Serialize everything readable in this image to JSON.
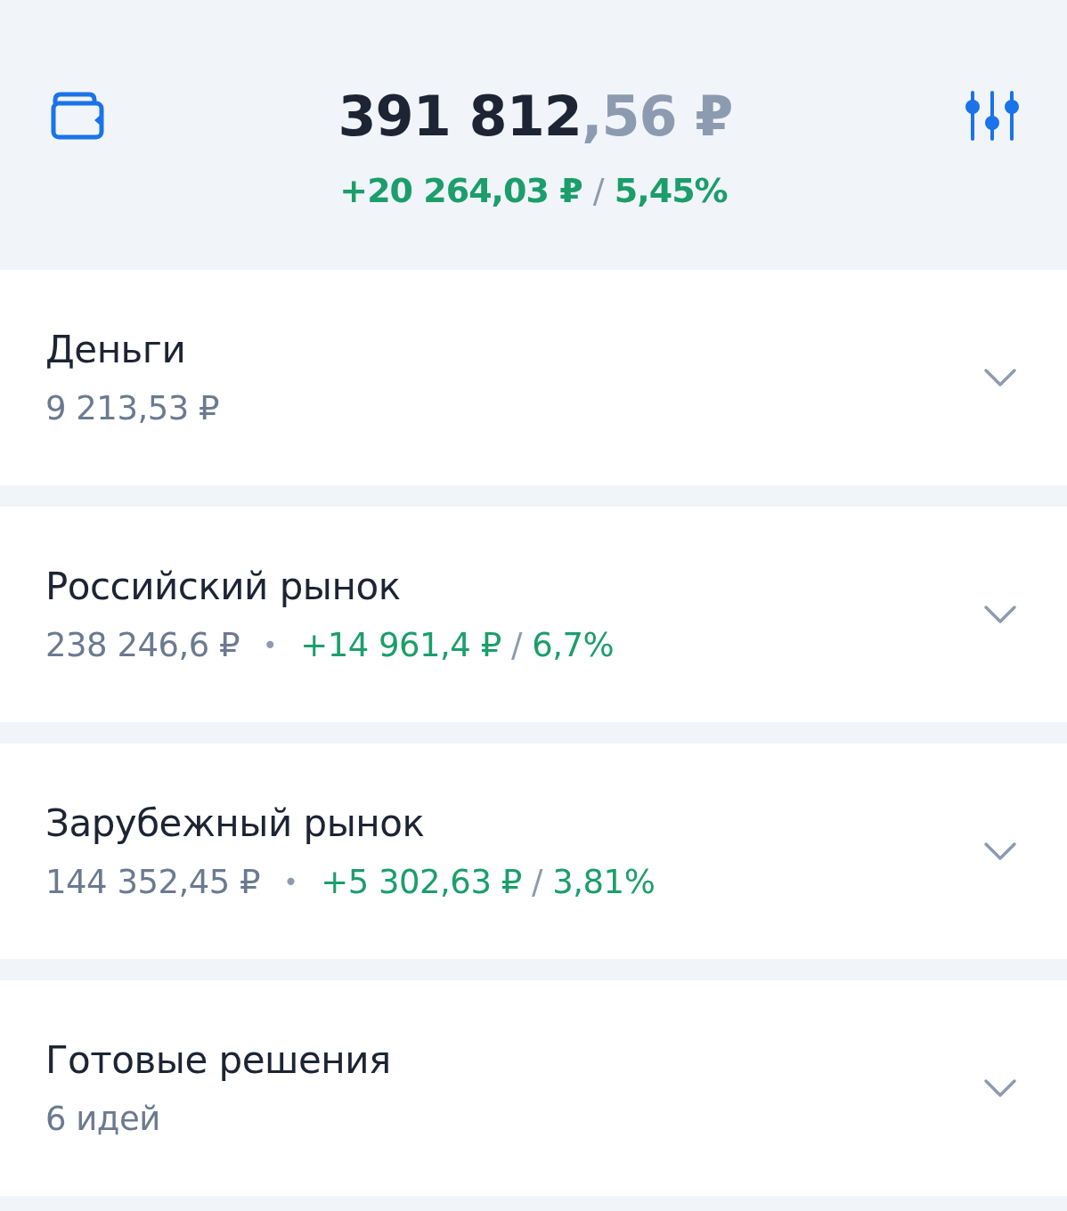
{
  "header": {
    "total_main": "391 812",
    "total_fraction": ",56",
    "currency": "₽",
    "change": "+20 264,03 ₽",
    "separator": "/",
    "percent": "5,45%"
  },
  "sections": [
    {
      "title": "Деньги",
      "value": "9 213,53 ₽",
      "expanded": false
    },
    {
      "title": "Российский рынок",
      "value": "238 246,6 ₽",
      "dot": "•",
      "change": "+14 961,4 ₽",
      "separator": "/",
      "percent": "6,7%",
      "expanded": false
    },
    {
      "title": "Зарубежный рынок",
      "value": "144 352,45 ₽",
      "dot": "•",
      "change": "+5 302,63 ₽",
      "separator": "/",
      "percent": "3,81%",
      "expanded": false
    },
    {
      "title": "Готовые решения",
      "value": "6 идей",
      "expanded": false
    }
  ]
}
